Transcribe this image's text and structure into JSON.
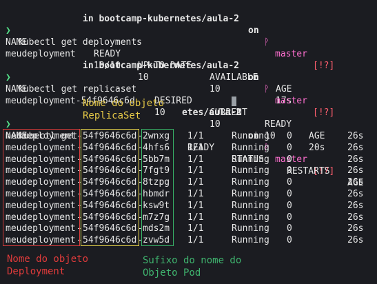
{
  "colors": {
    "background": "#1b1c21",
    "text": "#e6e6e6",
    "prompt": "#55e58b",
    "branch": "#ff6fd0",
    "status": "#ff5e6e",
    "deployment_box": "#d43a3a",
    "replicaset_box": "#e6d34a",
    "pod_box": "#38b468",
    "deployment_label": "#e03b3b",
    "replicaset_label": "#e6c947",
    "pod_label": "#3fb36e"
  },
  "icons": {
    "prompt_arrow": "❯",
    "branch_icon": "ᚹ"
  },
  "prompt_bar": {
    "path": "in bootcamp-kubernetes/aula-2",
    "on": "on",
    "branch": "master",
    "status": "[!?]"
  },
  "block1": {
    "command": "kubectl get deployments",
    "headers": [
      "NAME",
      "READY",
      "UP-TO-DATE",
      "AVAILABLE",
      "AGE"
    ],
    "row": [
      "meudeployment",
      "10/10",
      "10",
      "10",
      "17s"
    ]
  },
  "block2": {
    "command": "kubectl get replicaset",
    "headers": [
      "NAME",
      "DESIRED",
      "CURRENT",
      "READY",
      "AGE"
    ],
    "row": [
      "meudeployment-54f9646c6d",
      "10",
      "10",
      "10",
      "20s"
    ]
  },
  "block3": {
    "command": "kubectl get",
    "path_fragment": "etes/aula-2",
    "headers": [
      "NAME",
      "READY",
      "STATUS",
      "RESTARTS",
      "AGE"
    ],
    "pods": [
      {
        "deployment": "meudeployment",
        "replicaset": "54f9646c6d",
        "suffix": "2wnxg",
        "ready": "1/1",
        "status": "Running",
        "restarts": "0",
        "age": "26s"
      },
      {
        "deployment": "meudeployment",
        "replicaset": "54f9646c6d",
        "suffix": "4hfs6",
        "ready": "1/1",
        "status": "Running",
        "restarts": "0",
        "age": "26s"
      },
      {
        "deployment": "meudeployment",
        "replicaset": "54f9646c6d",
        "suffix": "5bb7m",
        "ready": "1/1",
        "status": "Running",
        "restarts": "0",
        "age": "26s"
      },
      {
        "deployment": "meudeployment",
        "replicaset": "54f9646c6d",
        "suffix": "7fgt9",
        "ready": "1/1",
        "status": "Running",
        "restarts": "0",
        "age": "26s"
      },
      {
        "deployment": "meudeployment",
        "replicaset": "54f9646c6d",
        "suffix": "8tzpg",
        "ready": "1/1",
        "status": "Running",
        "restarts": "0",
        "age": "26s"
      },
      {
        "deployment": "meudeployment",
        "replicaset": "54f9646c6d",
        "suffix": "hbmdr",
        "ready": "1/1",
        "status": "Running",
        "restarts": "0",
        "age": "26s"
      },
      {
        "deployment": "meudeployment",
        "replicaset": "54f9646c6d",
        "suffix": "ksw9t",
        "ready": "1/1",
        "status": "Running",
        "restarts": "0",
        "age": "26s"
      },
      {
        "deployment": "meudeployment",
        "replicaset": "54f9646c6d",
        "suffix": "m7z7g",
        "ready": "1/1",
        "status": "Running",
        "restarts": "0",
        "age": "26s"
      },
      {
        "deployment": "meudeployment",
        "replicaset": "54f9646c6d",
        "suffix": "mds2m",
        "ready": "1/1",
        "status": "Running",
        "restarts": "0",
        "age": "26s"
      },
      {
        "deployment": "meudeployment",
        "replicaset": "54f9646c6d",
        "suffix": "zvw5d",
        "ready": "1/1",
        "status": "Running",
        "restarts": "0",
        "age": "26s"
      }
    ]
  },
  "annotations": {
    "replicaset_line1": "Nome do objeto",
    "replicaset_line2": "ReplicaSet",
    "deployment_line1": "Nome do objeto",
    "deployment_line2": "Deployment",
    "pod_line1": "Sufixo do nome do",
    "pod_line2": "Objeto Pod"
  }
}
